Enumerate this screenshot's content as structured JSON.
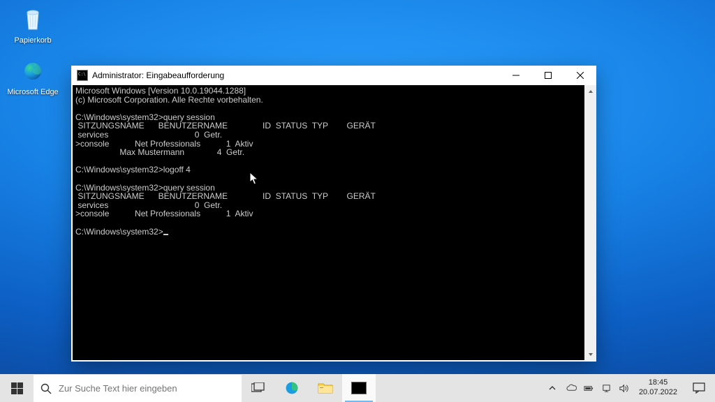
{
  "desktop": {
    "recycle_label": "Papierkorb",
    "edge_label": "Microsoft Edge"
  },
  "window": {
    "title": "Administrator: Eingabeaufforderung"
  },
  "terminal": {
    "line0": "Microsoft Windows [Version 10.0.19044.1288]",
    "line1": "(c) Microsoft Corporation. Alle Rechte vorbehalten.",
    "blank": "",
    "cmd1": "C:\\Windows\\system32>query session",
    "hdr": " SITZUNGSNAME      BENUTZERNAME               ID  STATUS  TYP        GERÄT",
    "s1a": " services                                     0  Getr.",
    "s1b": ">console           Net Professionals           1  Aktiv",
    "s1c": "                   Max Mustermann              4  Getr.",
    "cmd2": "C:\\Windows\\system32>logoff 4",
    "cmd3": "C:\\Windows\\system32>query session",
    "s2a": " services                                     0  Getr.",
    "s2b": ">console           Net Professionals           1  Aktiv",
    "prompt": "C:\\Windows\\system32>"
  },
  "taskbar": {
    "search_placeholder": "Zur Suche Text hier eingeben",
    "time": "18:45",
    "date": "20.07.2022"
  }
}
